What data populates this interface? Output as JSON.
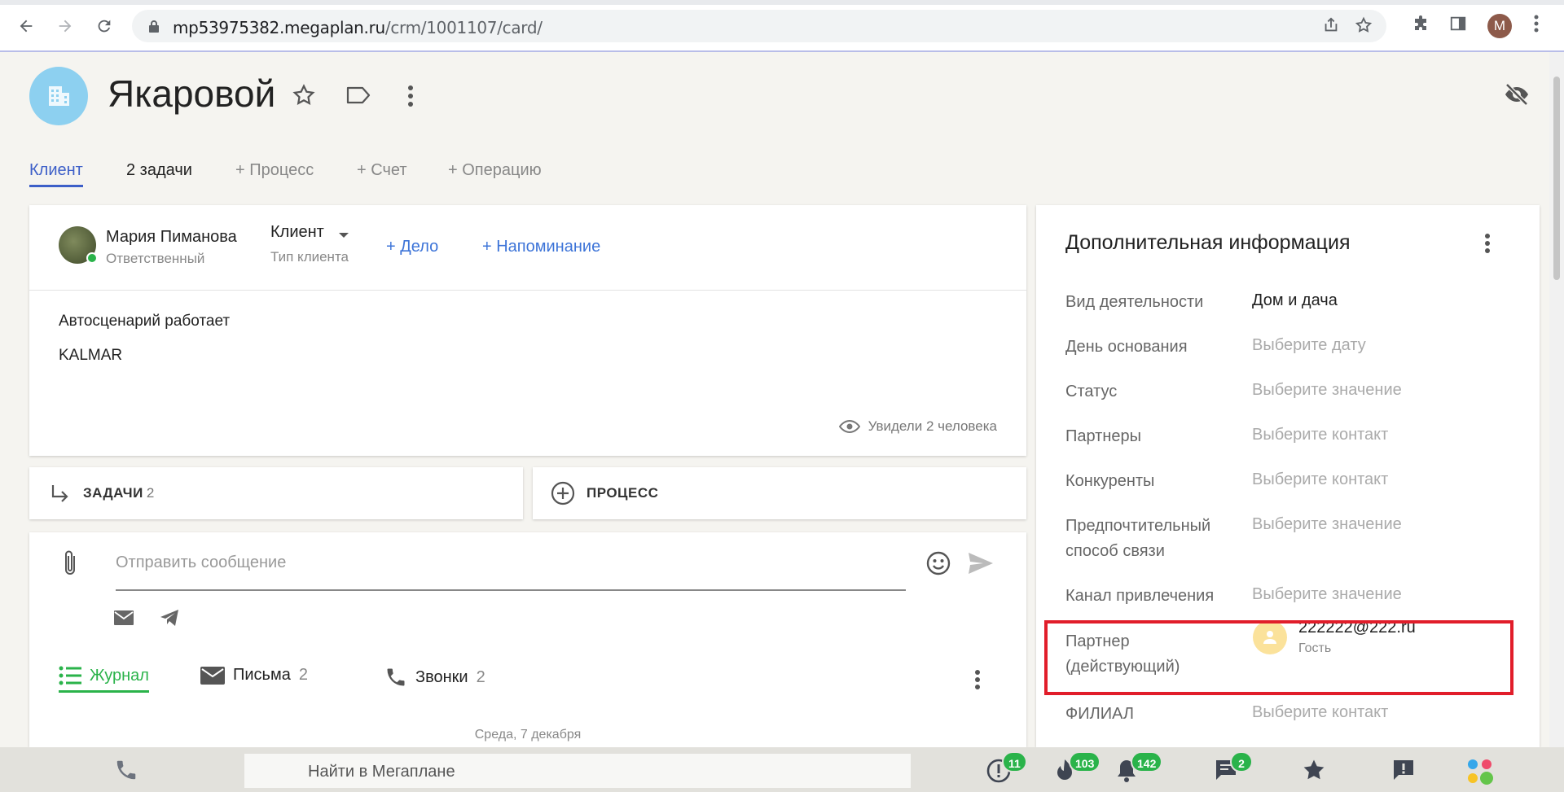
{
  "browser": {
    "url_host": "mp53975382.megaplan.ru",
    "url_path": "/crm/1001107/card/",
    "profile_initial": "M"
  },
  "page": {
    "title": "Якаровой"
  },
  "tabs": [
    {
      "label": "Клиент"
    },
    {
      "label": "2 задачи"
    },
    {
      "label": "+ Процесс"
    },
    {
      "label": "+ Счет"
    },
    {
      "label": "+ Операцию"
    }
  ],
  "main_card": {
    "responsible_name": "Мария Пиманова",
    "responsible_role": "Ответственный",
    "client_type": "Клиент",
    "client_type_label": "Тип клиента",
    "add_task": "+ Дело",
    "add_reminder": "+ Напоминание",
    "description": [
      "Автосценарий работает",
      "KALMAR"
    ],
    "seen_by": "Увидели 2 человека"
  },
  "sections": {
    "tasks_label": "ЗАДАЧИ",
    "tasks_count": "2",
    "process_label": "ПРОЦЕСС"
  },
  "message": {
    "placeholder": "Отправить сообщение",
    "journal_tabs": [
      {
        "label": "Журнал",
        "count": ""
      },
      {
        "label": "Письма",
        "count": "2"
      },
      {
        "label": "Звонки",
        "count": "2"
      }
    ],
    "day_separator": "Среда, 7 декабря"
  },
  "info": {
    "title": "Дополнительная информация",
    "fields": [
      {
        "label": "Вид деятельности",
        "value": "Дом и дача",
        "set": true
      },
      {
        "label": "День основания",
        "value": "Выберите дату",
        "set": false
      },
      {
        "label": "Статус",
        "value": "Выберите значение",
        "set": false
      },
      {
        "label": "Партнеры",
        "value": "Выберите контакт",
        "set": false
      },
      {
        "label": "Конкуренты",
        "value": "Выберите контакт",
        "set": false
      },
      {
        "label": "Предпочтительный способ связи",
        "value": "Выберите значение",
        "set": false
      },
      {
        "label": "Канал привлечения",
        "value": "Выберите значение",
        "set": false
      },
      {
        "label": "Партнер (действующий)",
        "value": "",
        "set": true
      },
      {
        "label": "ФИЛИАЛ",
        "value": "Выберите контакт",
        "set": false
      }
    ],
    "partner_email": "222222@222.ru",
    "partner_role": "Гость"
  },
  "bottom_bar": {
    "search_placeholder": "Найти в Мегаплане",
    "badges": {
      "alerts": "11",
      "hot": "103",
      "notifications": "142",
      "messages": "2"
    }
  },
  "colors": {
    "accent_blue": "#3d5fc8",
    "link_blue": "#3d74d8",
    "green": "#2ab34a",
    "highlight_red": "#e11d2a"
  }
}
